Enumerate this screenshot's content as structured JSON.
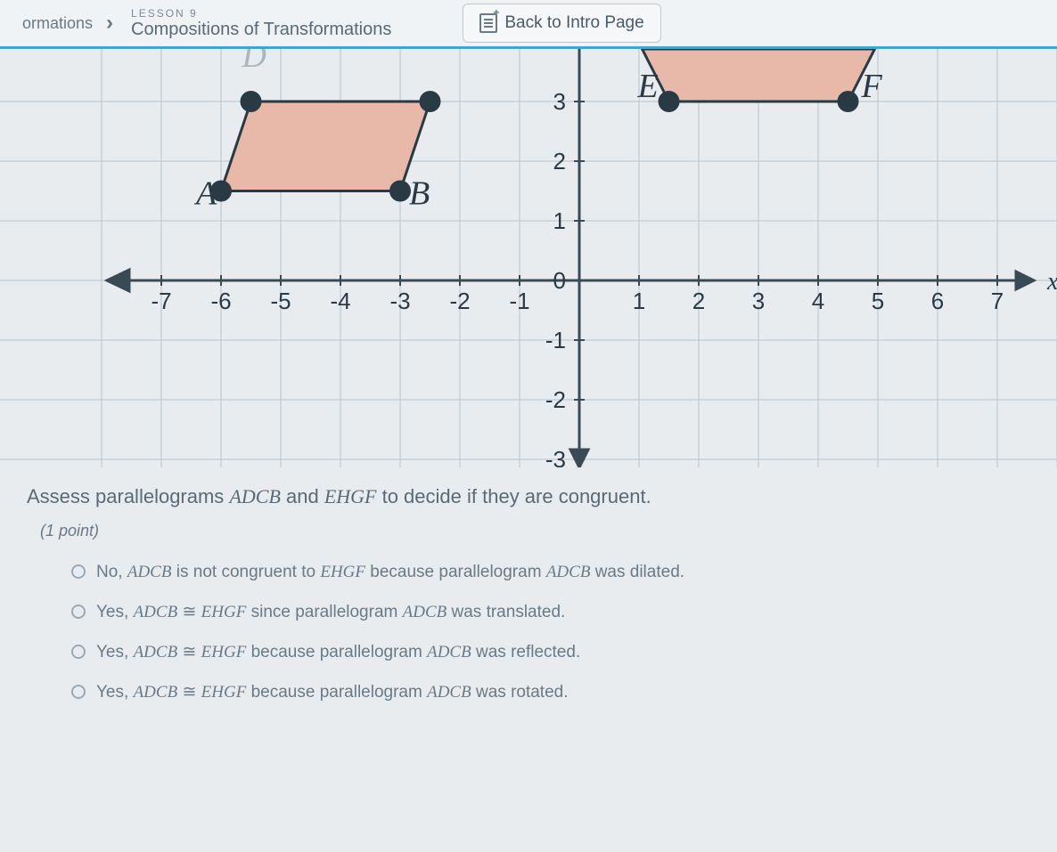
{
  "header": {
    "breadcrumb_prev": "ormations",
    "lesson_num": "LESSON 9",
    "lesson_title": "Compositions of Transformations",
    "back_label": "Back to Intro Page"
  },
  "chart_data": {
    "type": "scatter",
    "x_ticks": [
      -7,
      -6,
      -5,
      -4,
      -3,
      -2,
      -1,
      0,
      1,
      2,
      3,
      4,
      5,
      6,
      7
    ],
    "y_ticks": [
      -3,
      -2,
      -1,
      0,
      1,
      2,
      3
    ],
    "xaxis_arrow_label": "x",
    "shapes": [
      {
        "name": "ADCB",
        "points": {
          "A": [
            -6,
            1.5
          ],
          "B": [
            -3,
            1.5
          ],
          "C": [
            -2.5,
            3
          ],
          "D": [
            -5.5,
            3
          ]
        },
        "labels_visible": [
          "A",
          "B"
        ],
        "fill": "#e6b8a8"
      },
      {
        "name": "EHGF",
        "points": {
          "E": [
            1.5,
            3
          ],
          "F": [
            4.5,
            3
          ]
        },
        "labels_visible": [
          "E",
          "F"
        ],
        "fill": "#e6b8a8",
        "note": "partially clipped at top"
      }
    ]
  },
  "question": {
    "prompt_pre": "Assess parallelograms ",
    "prompt_shape1": "ADCB",
    "prompt_mid": " and ",
    "prompt_shape2": "EHGF",
    "prompt_post": " to decide if they are congruent.",
    "points_label": "(1 point)",
    "options": [
      {
        "pre": "No, ",
        "s1": "ADCB",
        "mid": " is not congruent to ",
        "s2": "EHGF",
        "mid2": " because parallelogram ",
        "s3": "ADCB",
        "post": " was dilated."
      },
      {
        "pre": "Yes, ",
        "s1": "ADCB",
        "rel": " ≅ ",
        "s2": "EHGF",
        "mid2": " since parallelogram ",
        "s3": "ADCB",
        "post": " was translated."
      },
      {
        "pre": "Yes, ",
        "s1": "ADCB",
        "rel": " ≅ ",
        "s2": "EHGF",
        "mid2": " because parallelogram ",
        "s3": "ADCB",
        "post": " was reflected."
      },
      {
        "pre": "Yes, ",
        "s1": "ADCB",
        "rel": " ≅ ",
        "s2": "EHGF",
        "mid2": " because parallelogram ",
        "s3": "ADCB",
        "post": " was rotated."
      }
    ]
  }
}
